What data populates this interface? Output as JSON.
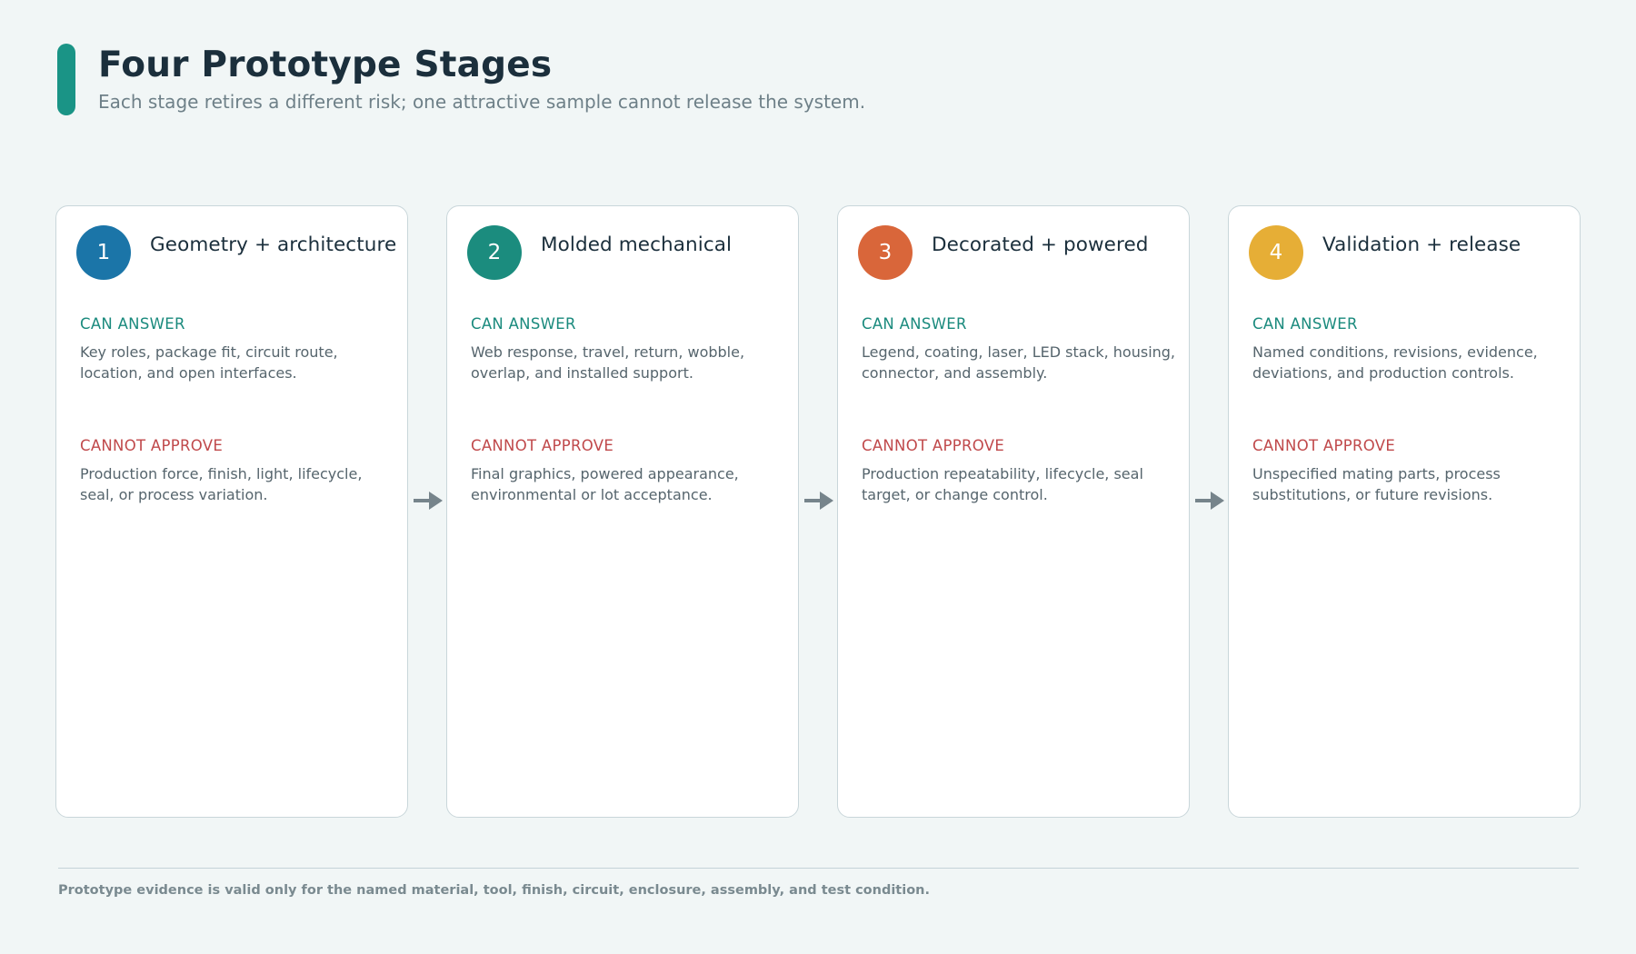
{
  "header": {
    "title": "Four Prototype Stages",
    "subtitle": "Each stage retires a different risk; one attractive sample cannot release the system."
  },
  "labels": {
    "can_answer": "CAN ANSWER",
    "cannot_approve": "CANNOT APPROVE"
  },
  "colors": {
    "accent": "#1a9486",
    "can_answer": "#1a8a7d",
    "cannot_approve": "#c0494b",
    "arrow": "#76848b"
  },
  "stages": [
    {
      "number": "1",
      "title": "Geometry + architecture",
      "color": "#1b75a8",
      "can_answer": "Key roles, package fit, circuit route, location, and open interfaces.",
      "cannot_approve": "Production force, finish, light, lifecycle, seal, or process variation."
    },
    {
      "number": "2",
      "title": "Molded mechanical",
      "color": "#1b8c7e",
      "can_answer": "Web response, travel, return, wobble, overlap, and installed support.",
      "cannot_approve": "Final graphics, powered appearance, environmental or lot acceptance."
    },
    {
      "number": "3",
      "title": "Decorated + powered",
      "color": "#d9663a",
      "can_answer": "Legend, coating, laser, LED stack, housing, connector, and assembly.",
      "cannot_approve": "Production repeatability, lifecycle, seal target, or change control."
    },
    {
      "number": "4",
      "title": "Validation + release",
      "color": "#e6ae36",
      "can_answer": "Named conditions, revisions, evidence, deviations, and production controls.",
      "cannot_approve": "Unspecified mating parts, process substitutions, or future revisions."
    }
  ],
  "footer": {
    "note": "Prototype evidence is valid only for the named material, tool, finish, circuit, enclosure, assembly, and test condition."
  }
}
